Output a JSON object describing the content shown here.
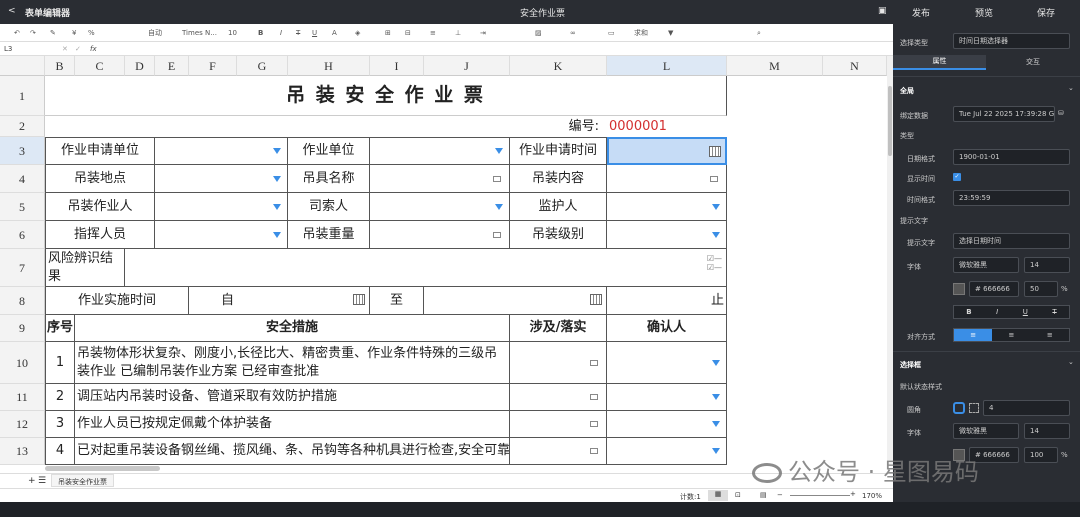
{
  "app": {
    "back_label": "<",
    "title": "表单编辑器",
    "doc_title": "安全作业票",
    "publish": "发布",
    "preview": "预览",
    "save": "保存"
  },
  "formula": {
    "cell_ref": "L3",
    "fx": "fx",
    "cancel": "✕",
    "confirm": "✓"
  },
  "toolbar": {
    "font": "Times N...",
    "size": "10",
    "fmt": "自动",
    "percent": "%",
    "currency": "¥",
    "bold": "B",
    "italic": "I",
    "strike": "T",
    "underline": "U",
    "sum": "求和"
  },
  "columns": [
    "B",
    "C",
    "D",
    "E",
    "F",
    "G",
    "H",
    "I",
    "J",
    "K",
    "L",
    "M",
    "N"
  ],
  "rows": [
    "1",
    "2",
    "3",
    "4",
    "5",
    "6",
    "7",
    "8",
    "9",
    "10",
    "11",
    "12",
    "13"
  ],
  "sheet": {
    "title": "吊 装 安 全 作 业 票",
    "code_label": "编号:",
    "code_value": "0000001",
    "r3": [
      "作业申请单位",
      "作业单位",
      "作业申请时间"
    ],
    "r4": [
      "吊装地点",
      "吊具名称",
      "吊装内容"
    ],
    "r5": [
      "吊装作业人",
      "司索人",
      "监护人"
    ],
    "r6": [
      "指挥人员",
      "吊装重量",
      "吊装级别"
    ],
    "risk": "风险辨识结果",
    "r8": [
      "作业实施时间",
      "自",
      "至",
      "止"
    ],
    "r9": [
      "序号",
      "安全措施",
      "涉及/落实",
      "确认人"
    ],
    "items": [
      {
        "n": "1",
        "t": "吊装物体形状复杂、刚度小,长径比大、精密贵重、作业条件特殊的三级吊装作业 已编制吊装作业方案 已经审查批准"
      },
      {
        "n": "2",
        "t": "调压站内吊装时设备、管道采取有效防护措施"
      },
      {
        "n": "3",
        "t": "作业人员已按规定佩戴个体护装备"
      },
      {
        "n": "4",
        "t": "已对起重吊装设备钢丝绳、揽风绳、条、吊钩等各种机具进行检查,安全可靠"
      }
    ]
  },
  "tabs": {
    "sheet_name": "吊装安全作业票",
    "add": "+"
  },
  "status": {
    "count": "计数:1",
    "zoom": "170%"
  },
  "panel": {
    "type_label": "选择类型",
    "type_value": "时间日期选择器",
    "tab_props": "属性",
    "tab_interact": "交互",
    "global": "全局",
    "bind_label": "绑定数据",
    "bind_value": "Tue Jul 22 2025 17:39:28 GA",
    "kind": "类型",
    "date_fmt_label": "日期格式",
    "date_fmt": "1900-01-01",
    "show_time_label": "显示时间",
    "time_fmt_label": "时间格式",
    "time_fmt": "23:59:59",
    "hint_section": "提示文字",
    "hint_label": "提示文字",
    "hint_value": "选择日期时间",
    "font_label": "字体",
    "font_value": "微软雅黑",
    "font_size": "14",
    "color": "# 666666",
    "opacity": "50",
    "pct": "%",
    "align_label": "对齐方式",
    "box_section": "选择框",
    "state_section": "默认状态样式",
    "radius_label": "圆角",
    "radius_value": "4",
    "font2_value": "微软雅黑",
    "font2_size": "14",
    "color2": "# 666666",
    "opacity2": "100"
  },
  "watermark": "公众号 · 星图易码"
}
